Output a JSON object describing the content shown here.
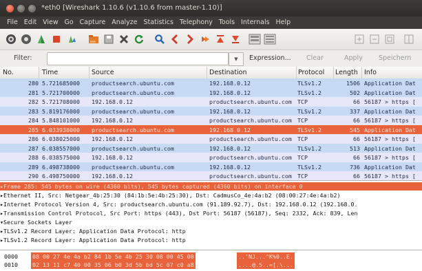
{
  "window": {
    "title": "*eth0  [Wireshark 1.10.6  (v1.10.6 from master-1.10)]"
  },
  "menu": [
    "File",
    "Edit",
    "View",
    "Go",
    "Capture",
    "Analyze",
    "Statistics",
    "Telephony",
    "Tools",
    "Internals",
    "Help"
  ],
  "toolbar_icons": [
    "interface-list-icon",
    "capture-options-icon",
    "start-capture-icon",
    "stop-capture-icon",
    "restart-capture-icon",
    "open-file-icon",
    "save-file-icon",
    "close-file-icon",
    "reload-icon",
    "find-packet-icon",
    "go-back-icon",
    "go-forward-icon",
    "go-to-packet-icon",
    "go-first-icon",
    "go-last-icon",
    "colorize-icon",
    "autoscroll-icon",
    "zoom-in-icon",
    "zoom-out-icon",
    "zoom-normal-icon",
    "resize-columns-icon"
  ],
  "filter": {
    "label": "Filter:",
    "value": "",
    "expression": "Expression...",
    "clear": "Clear",
    "apply": "Apply",
    "save": "Speichern"
  },
  "columns": {
    "no": "No.",
    "time": "Time",
    "source": "Source",
    "destination": "Destination",
    "protocol": "Protocol",
    "length": "Length",
    "info": "Info"
  },
  "packets": [
    {
      "no": "280",
      "time": "5.721685000",
      "src": "productsearch.ubuntu.com",
      "dst": "192.168.0.12",
      "proto": "TLSv1.2",
      "len": "1506",
      "info": "Application Dat",
      "kind": "tls"
    },
    {
      "no": "281",
      "time": "5.721700000",
      "src": "productsearch.ubuntu.com",
      "dst": "192.168.0.12",
      "proto": "TLSv1.2",
      "len": "502",
      "info": "Application Dat",
      "kind": "tls"
    },
    {
      "no": "282",
      "time": "5.721708000",
      "src": "192.168.0.12",
      "dst": "productsearch.ubuntu.com",
      "proto": "TCP",
      "len": "66",
      "info": "56187 > https [",
      "kind": "tcp"
    },
    {
      "no": "283",
      "time": "5.819176000",
      "src": "productsearch.ubuntu.com",
      "dst": "192.168.0.12",
      "proto": "TLSv1.2",
      "len": "337",
      "info": "Application Dat",
      "kind": "tls"
    },
    {
      "no": "284",
      "time": "5.848101000",
      "src": "192.168.0.12",
      "dst": "productsearch.ubuntu.com",
      "proto": "TCP",
      "len": "66",
      "info": "56187 > https [",
      "kind": "tcp"
    },
    {
      "no": "285",
      "time": "6.033938000",
      "src": "productsearch.ubuntu.com",
      "dst": "192.168.0.12",
      "proto": "TLSv1.2",
      "len": "545",
      "info": "Application Dat",
      "kind": "sel"
    },
    {
      "no": "286",
      "time": "6.038025000",
      "src": "192.168.0.12",
      "dst": "productsearch.ubuntu.com",
      "proto": "TCP",
      "len": "66",
      "info": "56187 > https [",
      "kind": "tcp"
    },
    {
      "no": "287",
      "time": "6.038557000",
      "src": "productsearch.ubuntu.com",
      "dst": "192.168.0.12",
      "proto": "TLSv1.2",
      "len": "513",
      "info": "Application Dat",
      "kind": "tls"
    },
    {
      "no": "288",
      "time": "6.038575000",
      "src": "192.168.0.12",
      "dst": "productsearch.ubuntu.com",
      "proto": "TCP",
      "len": "66",
      "info": "56187 > https [",
      "kind": "tcp"
    },
    {
      "no": "289",
      "time": "6.498738000",
      "src": "productsearch.ubuntu.com",
      "dst": "192.168.0.12",
      "proto": "TLSv1.2",
      "len": "736",
      "info": "Application Dat",
      "kind": "tls"
    },
    {
      "no": "290",
      "time": "6.498750000",
      "src": "192.168.0.12",
      "dst": "productsearch.ubuntu.com",
      "proto": "TCP",
      "len": "66",
      "info": "56187 > https [",
      "kind": "tcp"
    }
  ],
  "details": [
    "▸Frame 285: 545 bytes on wire (4360 bits), 545 bytes captured (4360 bits) on interface 0",
    "▸Ethernet II, Src: Netgear_4b:25:30 (84:1b:5e:4b:25:30), Dst: CadmusCo_4e:4a:b2 (08:00:27:4e:4a:b2)",
    "▸Internet Protocol Version 4, Src: productsearch.ubuntu.com (91.189.92.7), Dst: 192.168.0.12 (192.168.0.",
    "▸Transmission Control Protocol, Src Port: https (443), Dst Port: 56187 (56187), Seq: 2332, Ack: 839, Len",
    "▾Secure Sockets Layer",
    "  ▸TLSv1.2 Record Layer: Application Data Protocol: http",
    "  ▸TLSv1.2 Record Layer: Application Data Protocol: http"
  ],
  "hex": [
    {
      "offset": "0000",
      "bytes": "08 00 27 4e 4a b2 84 1b  5e 4b 25 30 08 00 45 00",
      "ascii": "..'NJ...^K%0..E."
    },
    {
      "offset": "0010",
      "bytes": "02 13 11 c7 40 00 35 06  b0 3d 5b bd 5c 07 c0 a8",
      "ascii": "....@.5..=[.\\..."
    }
  ]
}
